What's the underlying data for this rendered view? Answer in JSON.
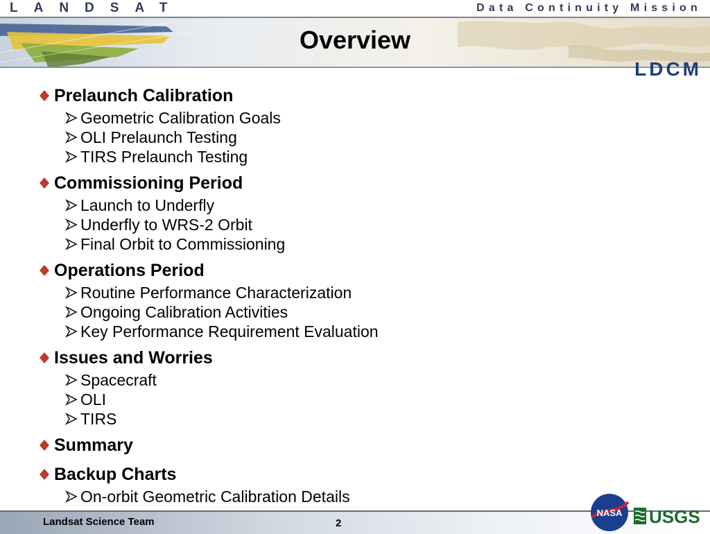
{
  "header": {
    "brand_left": "LANDSAT",
    "brand_right": "Data Continuity Mission",
    "logo_text": "LDCM",
    "title": "Overview"
  },
  "outline": [
    {
      "label": "Prelaunch Calibration",
      "items": [
        "Geometric Calibration Goals",
        "OLI Prelaunch Testing",
        "TIRS Prelaunch Testing"
      ]
    },
    {
      "label": "Commissioning Period",
      "items": [
        "Launch to Underfly",
        "Underfly to WRS-2 Orbit",
        "Final Orbit to Commissioning"
      ]
    },
    {
      "label": "Operations Period",
      "items": [
        "Routine Performance Characterization",
        "Ongoing Calibration Activities",
        "Key Performance Requirement Evaluation"
      ]
    },
    {
      "label": "Issues and Worries",
      "items": [
        "Spacecraft",
        "OLI",
        "TIRS"
      ]
    },
    {
      "label": "Summary",
      "items": []
    },
    {
      "label": "Backup Charts",
      "items": [
        "On-orbit Geometric Calibration Details"
      ]
    }
  ],
  "footer": {
    "team": "Landsat Science Team",
    "page_number": "2",
    "nasa_logo": "NASA",
    "usgs_logo": "USGS"
  },
  "colors": {
    "bullet": "#c0392b",
    "arrow": "#1a1a1a",
    "brand": "#2f3a55",
    "ldcm": "#1f3f7a",
    "usgs": "#1d6b2e"
  },
  "icons": {
    "section_bullet": "diamond-bullet-icon",
    "sub_bullet": "arrow-bullet-icon"
  }
}
